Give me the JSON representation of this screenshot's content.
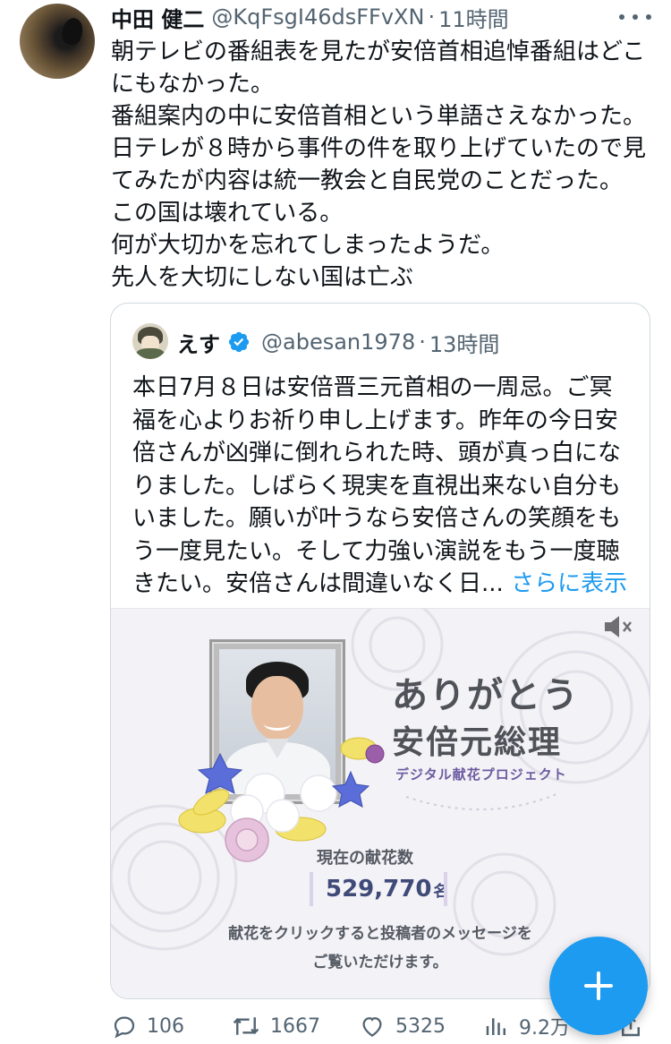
{
  "tweet": {
    "author_name": "中田 健二",
    "handle": "@KqFsgI46dsFFvXN",
    "separator": "·",
    "time": "11時間",
    "lines": [
      "朝テレビの番組表を見たが安倍首相追悼番組はどこ",
      "にもなかった。",
      "番組案内の中に安倍首相という単語さえなかった。",
      "日テレが８時から事件の件を取り上げていたので見",
      "てみたが内容は統一教会と自民党のことだった。",
      "この国は壊れている。",
      "何が大切かを忘れてしまったようだ。",
      "先人を大切にしない国は亡ぶ"
    ]
  },
  "quote": {
    "author_name": "えす",
    "handle": "@abesan1978",
    "separator": "·",
    "time": "13時間",
    "lines": [
      "本日7月８日は安倍晋三元首相の一周忌。ご冥",
      "福を心よりお祈り申し上げます。昨年の今日安",
      "倍さんが凶弾に倒れられた時、頭が真っ白にな",
      "りました。しばらく現実を直視出来ない自分も",
      "いました。願いが叶うなら安倍さんの笑顔をも",
      "う一度見たい。そして力強い演説をもう一度聴"
    ],
    "last_line": "きたい。安倍さんは間違いなく日...",
    "show_more": "さらに表示",
    "media": {
      "title1": "ありがとう",
      "title2": "安倍元総理",
      "subtitle": "デジタル献花プロジェクト",
      "count_label": "現在の献花数",
      "count": "529,770",
      "count_unit": "名",
      "note1": "献花をクリックすると投稿者のメッセージを",
      "note2": "ご覧いただけます。"
    }
  },
  "actions": {
    "replies": "106",
    "retweets": "1667",
    "likes": "5325",
    "views": "9.2万"
  },
  "icons": {
    "more": "more-dots-icon",
    "verified": "verified-badge-icon",
    "mute": "speaker-muted-icon",
    "reply": "reply-bubble-icon",
    "retweet": "retweet-icon",
    "like": "heart-icon",
    "views": "views-bars-icon",
    "share": "share-icon",
    "compose": "plus-icon"
  },
  "colors": {
    "accent": "#1d9bf0",
    "text": "#0f1419",
    "muted": "#536471",
    "border": "#cfd9de"
  }
}
